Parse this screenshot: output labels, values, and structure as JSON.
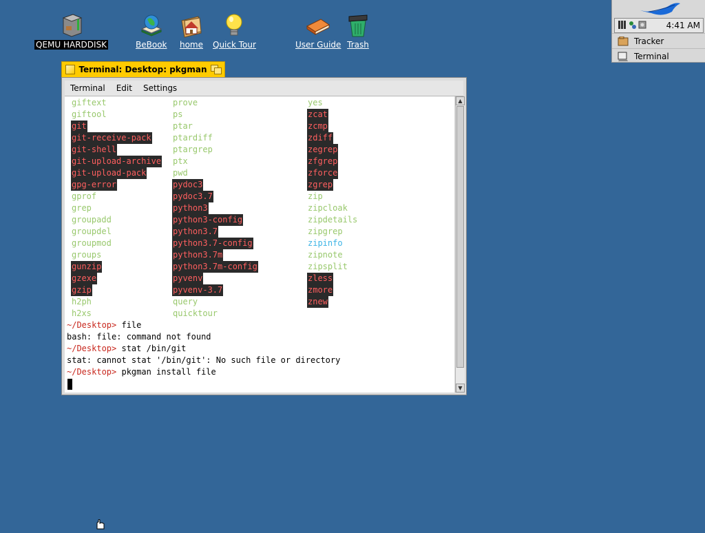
{
  "desktop_icons": [
    {
      "label": "QEMU HARDDISK",
      "icon": "harddisk-icon"
    },
    {
      "label": "BeBook",
      "icon": "bebook-icon"
    },
    {
      "label": "home",
      "icon": "home-folder-icon"
    },
    {
      "label": "Quick Tour",
      "icon": "lightbulb-icon"
    },
    {
      "label": "User Guide",
      "icon": "book-icon"
    },
    {
      "label": "Trash",
      "icon": "trash-icon"
    }
  ],
  "deskbar": {
    "clock": "4:41 AM",
    "items": [
      {
        "label": "Tracker",
        "icon": "tracker-icon"
      },
      {
        "label": "Terminal",
        "icon": "terminal-icon"
      }
    ]
  },
  "window": {
    "title": "Terminal: Desktop: pkgman",
    "menu": [
      "Terminal",
      "Edit",
      "Settings"
    ]
  },
  "listing": {
    "rows": [
      [
        [
          "giftext",
          "g"
        ],
        [
          "prove",
          "g"
        ],
        [
          "yes",
          "g"
        ]
      ],
      [
        [
          "giftool",
          "g"
        ],
        [
          "ps",
          "g"
        ],
        [
          "zcat",
          "r"
        ]
      ],
      [
        [
          "git",
          "r"
        ],
        [
          "ptar",
          "g"
        ],
        [
          "zcmp",
          "r"
        ]
      ],
      [
        [
          "git-receive-pack",
          "r"
        ],
        [
          "ptardiff",
          "g"
        ],
        [
          "zdiff",
          "r"
        ]
      ],
      [
        [
          "git-shell",
          "r"
        ],
        [
          "ptargrep",
          "g"
        ],
        [
          "zegrep",
          "r"
        ]
      ],
      [
        [
          "git-upload-archive",
          "r"
        ],
        [
          "ptx",
          "g"
        ],
        [
          "zfgrep",
          "r"
        ]
      ],
      [
        [
          "git-upload-pack",
          "r"
        ],
        [
          "pwd",
          "g"
        ],
        [
          "zforce",
          "r"
        ]
      ],
      [
        [
          "gpg-error",
          "r"
        ],
        [
          "pydoc3",
          "r"
        ],
        [
          "zgrep",
          "r"
        ]
      ],
      [
        [
          "gprof",
          "g"
        ],
        [
          "pydoc3.7",
          "r"
        ],
        [
          "zip",
          "g"
        ]
      ],
      [
        [
          "grep",
          "g"
        ],
        [
          "python3",
          "r"
        ],
        [
          "zipcloak",
          "g"
        ]
      ],
      [
        [
          "groupadd",
          "g"
        ],
        [
          "python3-config",
          "r"
        ],
        [
          "zipdetails",
          "g"
        ]
      ],
      [
        [
          "groupdel",
          "g"
        ],
        [
          "python3.7",
          "r"
        ],
        [
          "zipgrep",
          "g"
        ]
      ],
      [
        [
          "groupmod",
          "g"
        ],
        [
          "python3.7-config",
          "r"
        ],
        [
          "zipinfo",
          "b"
        ]
      ],
      [
        [
          "groups",
          "g"
        ],
        [
          "python3.7m",
          "r"
        ],
        [
          "zipnote",
          "g"
        ]
      ],
      [
        [
          "gunzip",
          "r"
        ],
        [
          "python3.7m-config",
          "r"
        ],
        [
          "zipsplit",
          "g"
        ]
      ],
      [
        [
          "gzexe",
          "r"
        ],
        [
          "pyvenv",
          "r"
        ],
        [
          "zless",
          "r"
        ]
      ],
      [
        [
          "gzip",
          "r"
        ],
        [
          "pyvenv-3.7",
          "r"
        ],
        [
          "zmore",
          "r"
        ]
      ],
      [
        [
          "h2ph",
          "g"
        ],
        [
          "query",
          "g"
        ],
        [
          "znew",
          "r"
        ]
      ],
      [
        [
          "h2xs",
          "g"
        ],
        [
          "quicktour",
          "g"
        ],
        [
          "",
          ""
        ]
      ]
    ]
  },
  "session": [
    {
      "prompt": "~/Desktop>",
      "text": " file"
    },
    {
      "prompt": "",
      "text": "bash: file: command not found"
    },
    {
      "prompt": "~/Desktop>",
      "text": " stat /bin/git"
    },
    {
      "prompt": "",
      "text": "stat: cannot stat '/bin/git': No such file or directory"
    },
    {
      "prompt": "~/Desktop>",
      "text": " pkgman install file"
    }
  ],
  "colors": {
    "desktop": "#336698",
    "tab": "#ffcb00",
    "listing_green": "#98c86c",
    "listing_red": "#ff5f5f",
    "listing_cyan": "#3cb4e6",
    "prompt": "#c8281e"
  }
}
